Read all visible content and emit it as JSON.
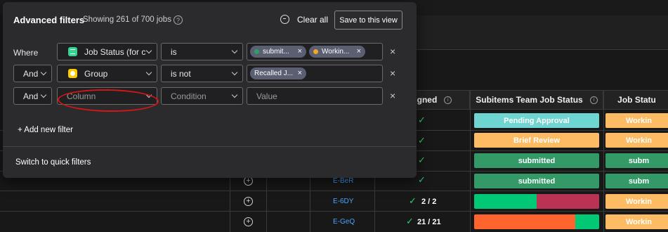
{
  "panel": {
    "title": "Advanced filters",
    "count_text": "Showing 261 of 700 jobs",
    "clear_all": "Clear all",
    "save_view": "Save to this view",
    "add_filter": "+ Add new filter",
    "quick_filters": "Switch to quick filters",
    "rows": [
      {
        "conjunction": "Where",
        "column": "Job Status (for c",
        "condition": "is",
        "chips": [
          {
            "label": "submit...",
            "color": "#2e9e6a"
          },
          {
            "label": "Workin...",
            "color": "#f5a623"
          }
        ]
      },
      {
        "conjunction": "And",
        "column": "Group",
        "condition": "is not",
        "chips": [
          {
            "label": "Recalled J..."
          }
        ]
      },
      {
        "conjunction": "And",
        "column": "Column",
        "condition": "Condition",
        "value": "Value"
      }
    ]
  },
  "board": {
    "headers": {
      "assigned": "s Assigned",
      "team_status": "Subitems Team Job Status",
      "job_status": "Job Statu"
    },
    "rows": [
      {
        "status": "Pending Approval",
        "status_color": "#6fd5d1",
        "job": "Workin"
      },
      {
        "status": "Brief Review",
        "status_color": "#fdbc64",
        "job": "Workin"
      },
      {
        "status": "submitted",
        "status_color": "#339966",
        "job": "subm"
      },
      {
        "status": "submitted",
        "status_color": "#339966",
        "job": "subm",
        "id": "E-BeR"
      },
      {
        "id": "E-6DY",
        "count": "2 / 2",
        "job": "Workin",
        "bar": [
          {
            "c": "#00c875",
            "w": 0.5
          },
          {
            "c": "#bb3354",
            "w": 0.5
          }
        ]
      },
      {
        "id": "E-GeQ",
        "count": "21 / 21",
        "job": "Workin",
        "bar": [
          {
            "c": "#ff642e",
            "w": 0.81
          },
          {
            "c": "#00c875",
            "w": 0.19
          }
        ]
      }
    ]
  },
  "colors": {
    "accent_red_annotation": "#d41616",
    "working": "#fdbc64",
    "submitted": "#339966"
  }
}
